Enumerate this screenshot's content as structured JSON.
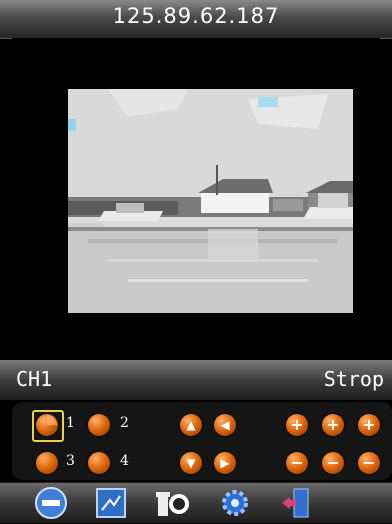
{
  "header": {
    "address": "125.89.62.187"
  },
  "status": {
    "channel": "CH1",
    "mode": "Strop"
  },
  "channels": [
    {
      "label": "1",
      "selected": true
    },
    {
      "label": "2",
      "selected": false
    },
    {
      "label": "3",
      "selected": false
    },
    {
      "label": "4",
      "selected": false
    }
  ],
  "ptz": {
    "icons": [
      "arrow-up-icon",
      "arrow-left-icon",
      "arrow-down-icon",
      "arrow-right-icon"
    ]
  },
  "adjust": {
    "plus": [
      "+",
      "+",
      "+"
    ],
    "minus": [
      "−",
      "−",
      "−"
    ]
  },
  "toolbar": {
    "icons": [
      "stop-icon",
      "snapshot-icon",
      "record-icon",
      "settings-icon",
      "exit-icon"
    ]
  },
  "colors": {
    "accent": "#e06a10",
    "selection": "#e8d24a"
  }
}
